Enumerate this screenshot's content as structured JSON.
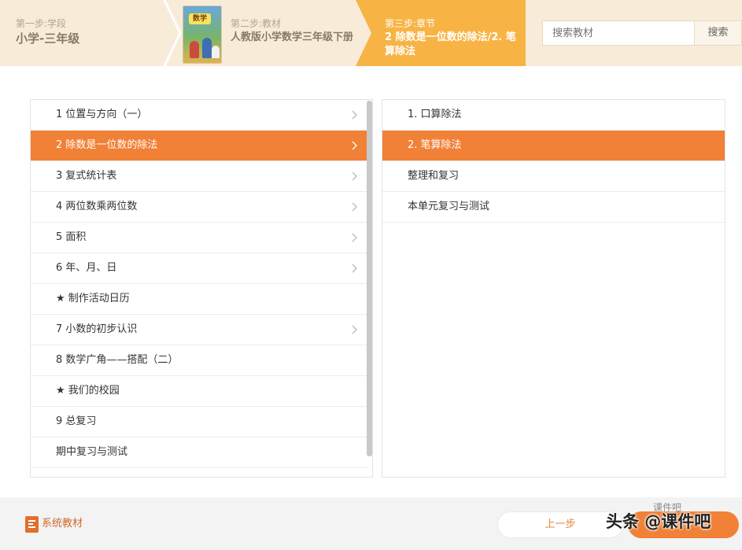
{
  "header": {
    "step1": {
      "label": "第一步:学段",
      "value": "小学-三年级"
    },
    "step2": {
      "label": "第二步:教材",
      "value": "人教版小学数学三年级下册",
      "cover_title": "数学"
    },
    "step3": {
      "label": "第三步:章节",
      "value": "2 除数是一位数的除法/2. 笔算除法"
    },
    "search": {
      "placeholder": "搜索教材",
      "button_label": "搜索"
    },
    "colors": {
      "header_bg": "#f8ecd9",
      "active_step": "#f7b445"
    }
  },
  "chapters": {
    "items": [
      {
        "label": "1 位置与方向（一）",
        "has_children": true,
        "active": false
      },
      {
        "label": "2 除数是一位数的除法",
        "has_children": true,
        "active": true
      },
      {
        "label": "3 复式统计表",
        "has_children": true,
        "active": false
      },
      {
        "label": "4 两位数乘两位数",
        "has_children": true,
        "active": false
      },
      {
        "label": "5 面积",
        "has_children": true,
        "active": false
      },
      {
        "label": "6 年、月、日",
        "has_children": true,
        "active": false
      },
      {
        "label": "★ 制作活动日历",
        "has_children": false,
        "active": false
      },
      {
        "label": "7 小数的初步认识",
        "has_children": true,
        "active": false
      },
      {
        "label": "8 数学广角——搭配（二）",
        "has_children": false,
        "active": false
      },
      {
        "label": "★ 我们的校园",
        "has_children": false,
        "active": false
      },
      {
        "label": "9 总复习",
        "has_children": false,
        "active": false
      },
      {
        "label": "期中复习与测试",
        "has_children": false,
        "active": false
      }
    ]
  },
  "sections": {
    "items": [
      {
        "label": "1. 口算除法",
        "active": false
      },
      {
        "label": "2. 笔算除法",
        "active": true
      },
      {
        "label": "整理和复习",
        "active": false
      },
      {
        "label": "本单元复习与测试",
        "active": false
      }
    ]
  },
  "footer": {
    "system_label": "系统教材",
    "prev_label": "上一步",
    "watermark": "头条 @课件吧",
    "watermark_sub": "课件吧"
  },
  "colors": {
    "accent": "#f08136"
  }
}
